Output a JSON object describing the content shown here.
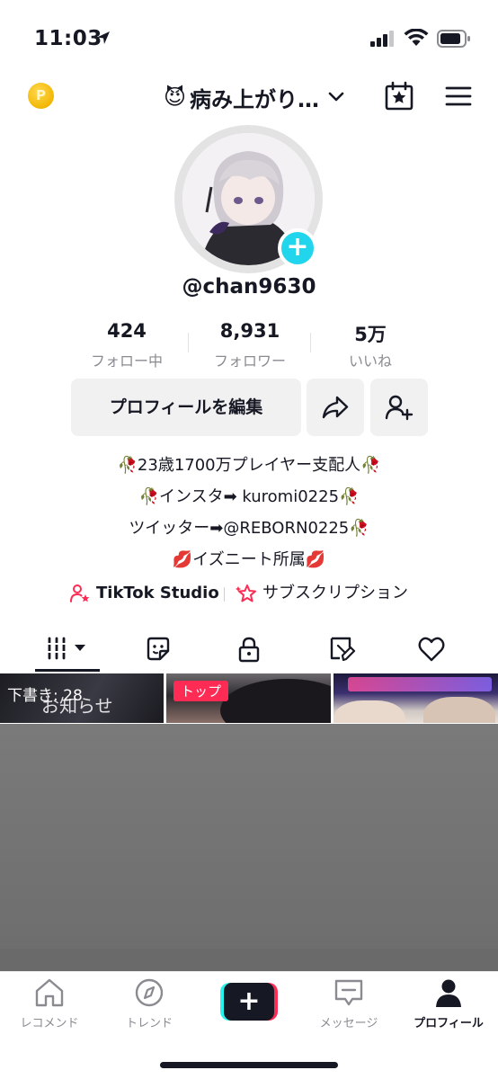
{
  "status_bar": {
    "time": "11:03"
  },
  "header": {
    "coin_label": "P",
    "account_emoji": "😈",
    "account_name": "病み上がり…",
    "icons": [
      "chevron-down-icon",
      "calendar-star-icon",
      "menu-icon"
    ]
  },
  "profile": {
    "handle": "@chan9630",
    "stats": [
      {
        "value": "424",
        "label": "フォロー中"
      },
      {
        "value": "8,931",
        "label": "フォロワー"
      },
      {
        "value": "5万",
        "label": "いいね"
      }
    ],
    "edit_button": "プロフィールを編集",
    "bio": [
      "🥀23歳1700万プレイヤー支配人🥀",
      "🥀インスタ➡ kuromi0225🥀",
      "ツイッター➡@REBORN0225🥀",
      "💋イズニート所属💋"
    ],
    "links": [
      {
        "label": "TikTok Studio",
        "icon": "person-star-icon"
      },
      {
        "label": "サブスクリプション",
        "icon": "sparkle-star-icon"
      }
    ]
  },
  "tabs": [
    "videos-grid-icon",
    "sticker-icon",
    "lock-icon",
    "tagged-icon",
    "heart-icon"
  ],
  "grid": {
    "draft_label": "下書き: 28",
    "draft_overlay": "お知らせ",
    "pinned_label": "トップ"
  },
  "bottom_nav": [
    {
      "label": "レコメンド",
      "icon": "home-icon"
    },
    {
      "label": "トレンド",
      "icon": "compass-icon"
    },
    {
      "label": "",
      "icon": "create-plus-icon"
    },
    {
      "label": "メッセージ",
      "icon": "message-icon"
    },
    {
      "label": "プロフィール",
      "icon": "profile-icon"
    }
  ],
  "colors": {
    "accent_cyan": "#20d5ec",
    "accent_red": "#fe2c55",
    "text": "#161823",
    "muted": "#8a8b91"
  }
}
